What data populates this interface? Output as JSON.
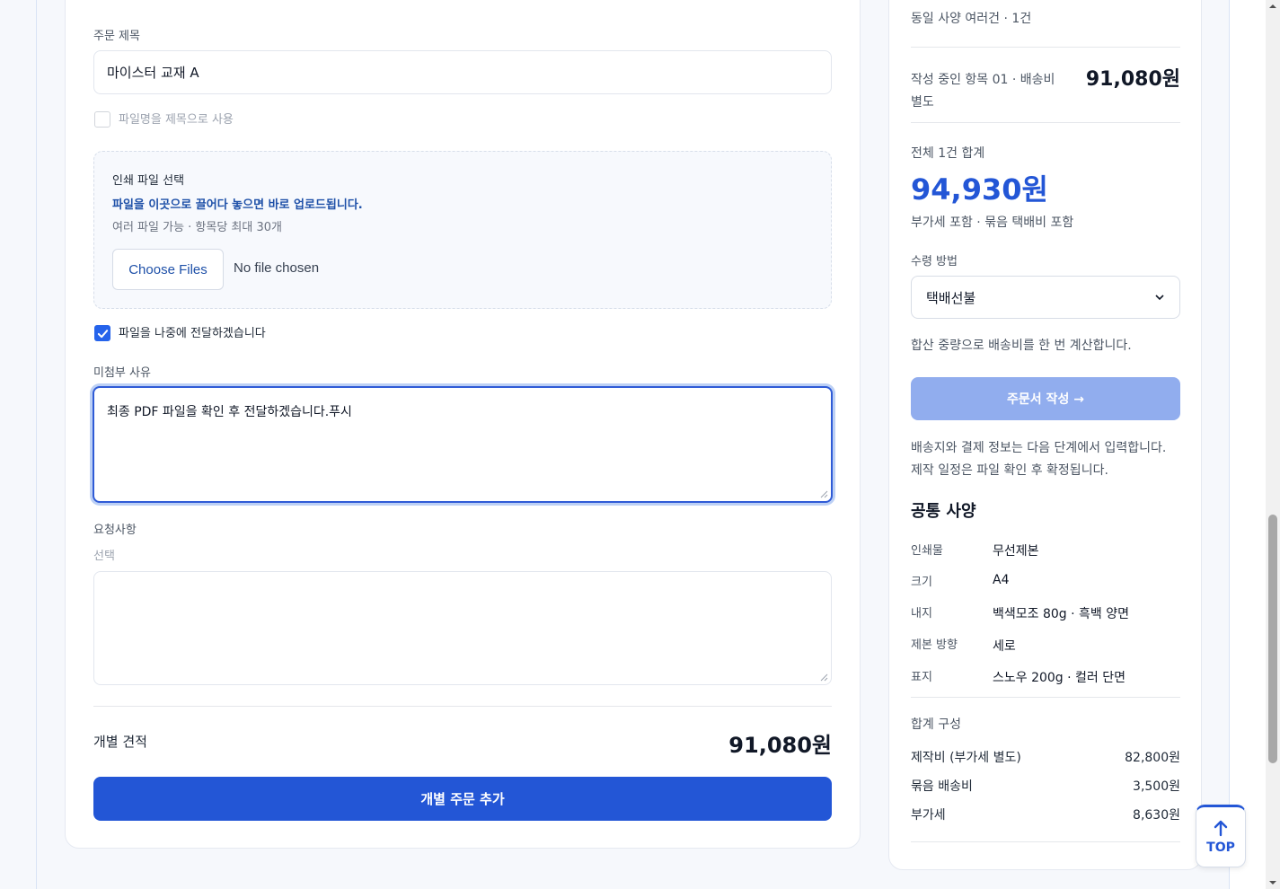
{
  "form": {
    "title_label": "주문 제목",
    "title_value": "마이스터 교재 A",
    "use_filename_label": "파일명을 제목으로 사용",
    "use_filename_checked": false,
    "upload": {
      "heading": "인쇄 파일 선택",
      "hint": "파일을 이곳으로 끌어다 놓으면 바로 업로드됩니다.",
      "sub": "여러 파일 가능 · 항목당 최대 30개",
      "choose_label": "Choose Files",
      "status": "No file chosen"
    },
    "send_later_label": "파일을 나중에 전달하겠습니다",
    "send_later_checked": true,
    "reason_label": "미첨부 사유",
    "reason_value": "최종 PDF 파일을 확인 후 전달하겠습니다.푸시",
    "request_label": "요청사항",
    "request_hint": "선택",
    "request_value": "",
    "quote_label": "개별 견적",
    "quote_value": "91,080원",
    "add_button": "개별 주문 추가"
  },
  "sidebar": {
    "mode_summary": "동일 사양 여러건 · 1건",
    "current_item_line1": "작성 중인 항목 01 · 배송비",
    "current_item_line2": "별도",
    "current_item_price": "91,080원",
    "total_label": "전체 1건 합계",
    "total_value": "94,930원",
    "total_note": "부가세 포함 · 묶음 택배비 포함",
    "delivery_label": "수령 방법",
    "delivery_value": "택배선불",
    "delivery_note": "합산 중량으로 배송비를 한 번 계산합니다.",
    "order_button": "주문서 작성 →",
    "info_line1": "배송지와 결제 정보는 다음 단계에서 입력합니다.",
    "info_line2": "제작 일정은 파일 확인 후 확정됩니다.",
    "specs_title": "공통 사양",
    "specs": [
      {
        "key": "인쇄물",
        "value": "무선제본"
      },
      {
        "key": "크기",
        "value": "A4"
      },
      {
        "key": "내지",
        "value": "백색모조 80g · 흑백 양면"
      },
      {
        "key": "제본 방향",
        "value": "세로"
      },
      {
        "key": "표지",
        "value": "스노우 200g · 컬러 단면"
      }
    ],
    "breakdown_title": "합계 구성",
    "breakdown": [
      {
        "key": "제작비 (부가세 별도)",
        "value": "82,800원"
      },
      {
        "key": "묶음 배송비",
        "value": "3,500원"
      },
      {
        "key": "부가세",
        "value": "8,630원"
      }
    ]
  },
  "top_button": "TOP",
  "colors": {
    "primary": "#2356d6",
    "primary_disabled": "#91adee",
    "hint_text": "#1e50a8"
  }
}
